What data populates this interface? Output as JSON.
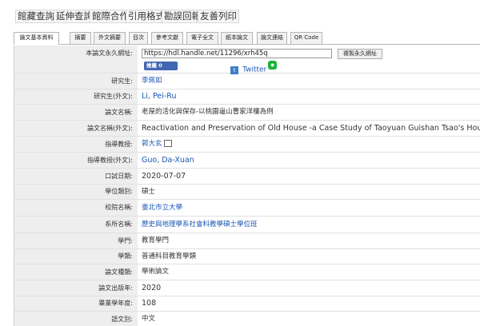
{
  "toolbar": {
    "buttons": [
      "館藏查詢",
      "延伸查詢",
      "館際合作",
      "引用格式",
      "勘誤回報",
      "友善列印"
    ]
  },
  "tabs": [
    "論文基本資料",
    "摘要",
    "外文摘要",
    "目次",
    "參考文獻",
    "電子全文",
    "紙本論文",
    "論文連結",
    "QR Code"
  ],
  "permalink": {
    "label": "本論文永久網址:",
    "url": "https://hdl.handle.net/11296/xrh45q",
    "button": "複製永久網址"
  },
  "share": {
    "facebook": "推薦 0",
    "twitter": "Twitter"
  },
  "fields": {
    "author_label": "研究生:",
    "author": "李佩如",
    "author_en_label": "研究生(外文):",
    "author_en": "Li, Pei-Ru",
    "title_label": "論文名稱:",
    "title": "老屋的活化與保存-以桃園龜山曹家洋樓為例",
    "title_en_label": "論文名稱(外文):",
    "title_en": "Reactivation and Preservation of Old House -a Case Study of Taoyuan Guishan Tsao's House",
    "advisor_label": "指導教授:",
    "advisor": "郭大玄",
    "advisor_en_label": "指導教授(外文):",
    "advisor_en": "Guo, Da-Xuan",
    "defense_date_label": "口試日期:",
    "defense_date": "2020-07-07",
    "degree_label": "學位類別:",
    "degree": "碩士",
    "school_label": "校院名稱:",
    "school": "臺北市立大學",
    "department_label": "系所名稱:",
    "department": "歷史與地理學系社會科教學碩士學位班",
    "discipline_label": "學門:",
    "discipline": "教育學門",
    "category_label": "學類:",
    "category": "普通科目教育學類",
    "thesis_type_label": "論文種類:",
    "thesis_type": "學術論文",
    "pub_year_label": "論文出版年:",
    "pub_year": "2020",
    "grad_year_label": "畢業學年度:",
    "grad_year": "108",
    "language_label": "語文別:",
    "language": "中文"
  }
}
